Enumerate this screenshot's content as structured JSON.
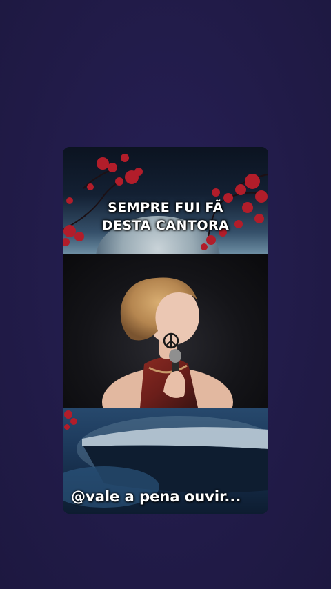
{
  "story": {
    "headline_line1": "SEMPRE FUI FÃ",
    "headline_line2": "DESTA CANTORA",
    "caption": "@vale a pena ouvir..."
  },
  "colors": {
    "background": "#211b48",
    "blossom": "#b21d2a",
    "headline_text": "#ffffff"
  },
  "icons": [
    "peace-sign-earring-icon"
  ]
}
